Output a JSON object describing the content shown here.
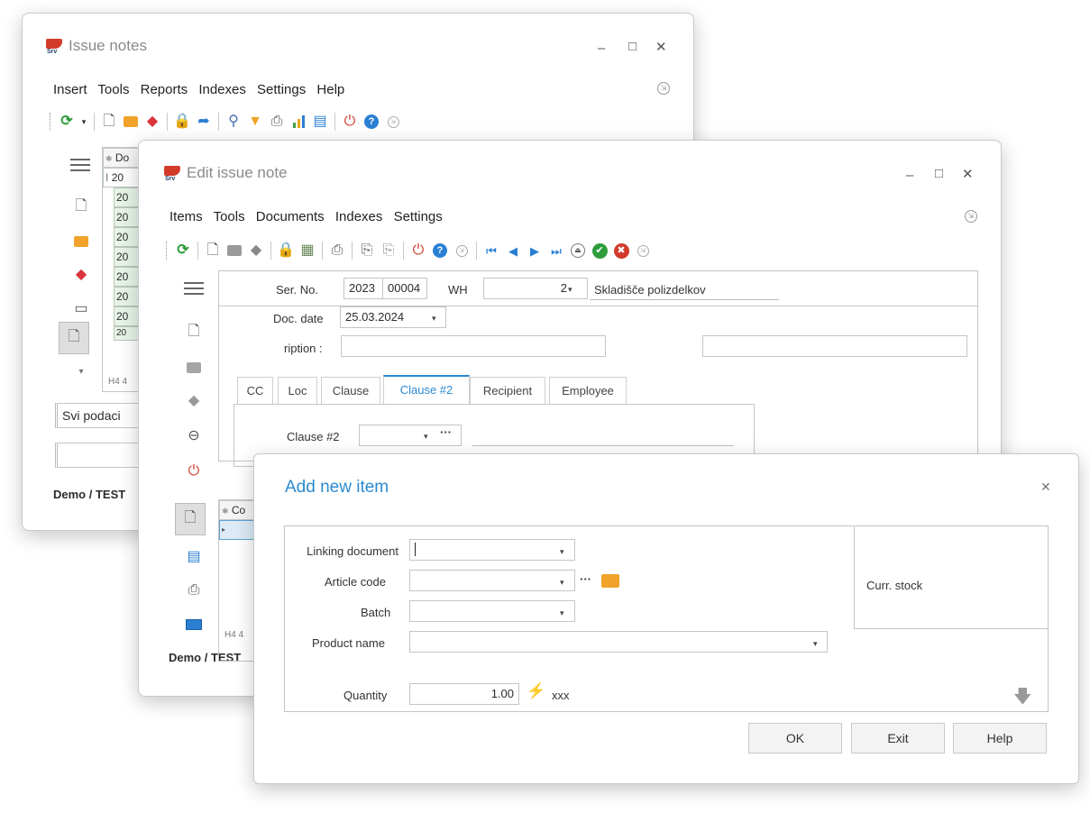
{
  "issue_window": {
    "title": "Issue notes",
    "menu": [
      "Insert",
      "Tools",
      "Reports",
      "Indexes",
      "Settings",
      "Help"
    ],
    "grid": {
      "header": "Do",
      "first_row": "20",
      "rows": [
        "20",
        "20",
        "20",
        "20",
        "20",
        "20",
        "20",
        "20"
      ]
    },
    "nav_label": "H4 4",
    "filter_value": "Svi podaci",
    "footer": "Demo / TEST"
  },
  "edit_window": {
    "title": "Edit issue note",
    "menu": [
      "Items",
      "Tools",
      "Documents",
      "Indexes",
      "Settings"
    ],
    "ser_no_label": "Ser. No.",
    "ser_year": "2023",
    "ser_num": "00004",
    "wh_label": "WH",
    "wh_value": "2",
    "wh_name": "Skladišče polizdelkov",
    "doc_date_label": "Doc. date",
    "doc_date_value": "25.03.2024",
    "description_label": "ription :",
    "tabs": [
      "CC",
      "Loc",
      "Clause",
      "Clause #2",
      "Recipient",
      "Employee"
    ],
    "active_tab": "Clause #2",
    "clause2_label": "Clause #2",
    "items_grid_header": "Co",
    "nav_label": "H4 4",
    "footer": "Demo / TEST"
  },
  "add_dialog": {
    "title": "Add new item",
    "linking_document_label": "Linking document",
    "article_code_label": "Article code",
    "batch_label": "Batch",
    "product_name_label": "Product name",
    "curr_stock_label": "Curr. stock",
    "quantity_label": "Quantity",
    "quantity_value": "1.00",
    "unit": "xxx",
    "ok_label": "OK",
    "exit_label": "Exit",
    "help_label": "Help"
  },
  "colors": {
    "accent": "#2b8ad2",
    "dialog_title": "#2a8bd0",
    "grid_row": "#e8f4e8"
  }
}
